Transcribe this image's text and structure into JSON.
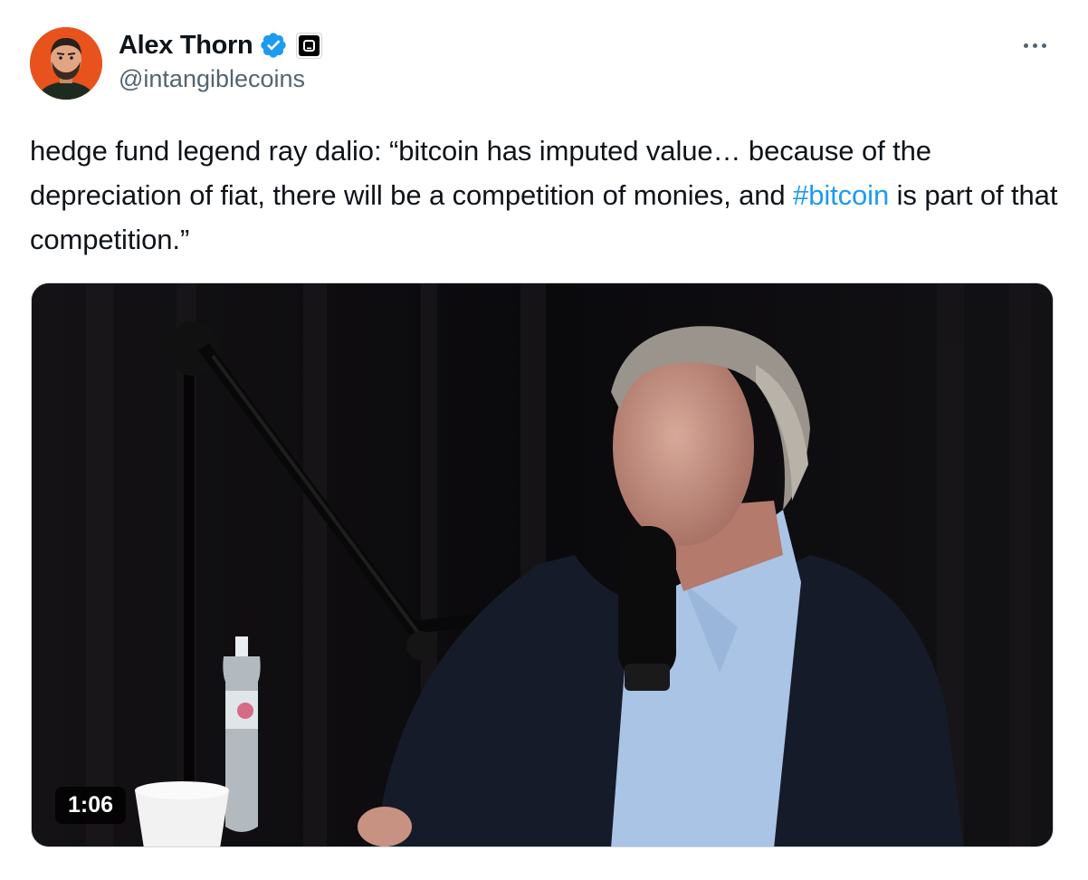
{
  "author": {
    "display_name": "Alex Thorn",
    "handle": "@intangiblecoins",
    "verified": true,
    "avatar_icon": "avatar-illustration",
    "avatar_bg": "#e8521d"
  },
  "tweet": {
    "text_part1": "hedge fund legend ray dalio: “bitcoin has imputed value… because of the depreciation of fiat, there will be a competition of monies, and ",
    "hashtag": "#bitcoin",
    "text_part2": " is part of that competition.”"
  },
  "media": {
    "type": "video",
    "duration": "1:06"
  },
  "colors": {
    "link": "#1d9bf0",
    "verified": "#1d9bf0",
    "secondary_text": "#536471"
  },
  "icons": {
    "more": "more-horizontal-icon",
    "verified": "verified-badge-icon",
    "affiliation": "affiliation-badge-icon"
  }
}
